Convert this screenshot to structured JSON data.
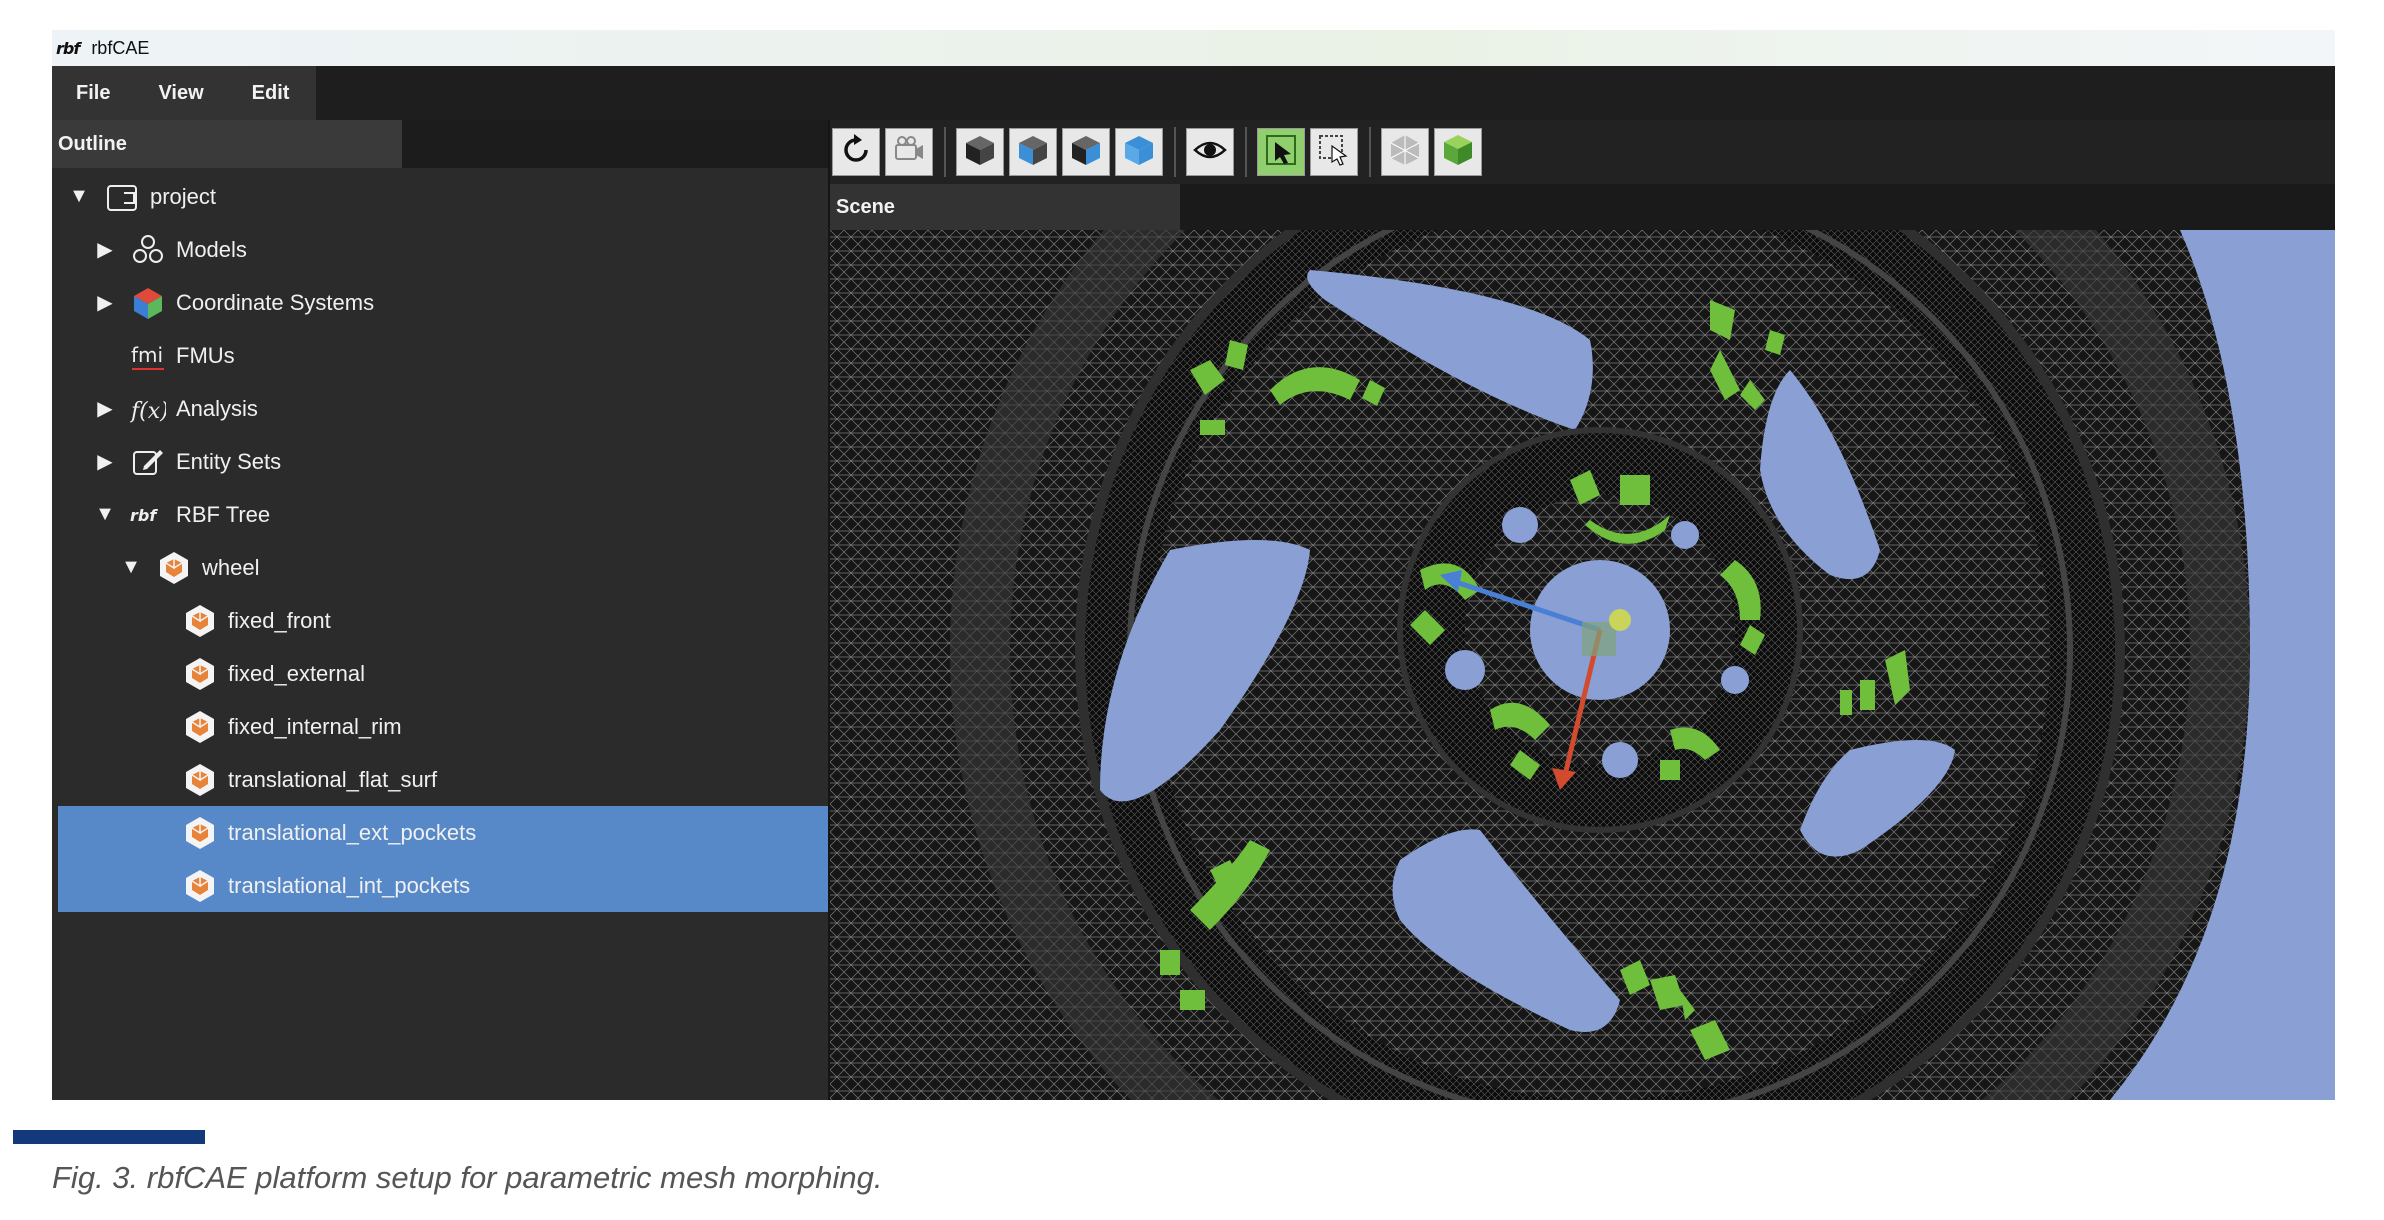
{
  "window": {
    "logo": "rbf",
    "title": "rbfCAE"
  },
  "menu": {
    "items": [
      "File",
      "View",
      "Edit"
    ]
  },
  "outline": {
    "tab_label": "Outline",
    "tree": [
      {
        "label": "project",
        "arrow": "▼",
        "icon": "folder-icon",
        "level": 0,
        "selected": false
      },
      {
        "label": "Models",
        "arrow": "▶",
        "icon": "models-icon",
        "level": 1,
        "selected": false
      },
      {
        "label": "Coordinate Systems",
        "arrow": "▶",
        "icon": "coordinate-systems-icon",
        "level": 1,
        "selected": false
      },
      {
        "label": "FMUs",
        "arrow": "",
        "icon": "fmi-icon",
        "level": 1,
        "selected": false
      },
      {
        "label": "Analysis",
        "arrow": "▶",
        "icon": "function-icon",
        "level": 1,
        "selected": false
      },
      {
        "label": "Entity Sets",
        "arrow": "▶",
        "icon": "edit-icon",
        "level": 1,
        "selected": false
      },
      {
        "label": "RBF Tree",
        "arrow": "▼",
        "icon": "rbf-icon",
        "level": 1,
        "selected": false
      },
      {
        "label": "wheel",
        "arrow": "▼",
        "icon": "rbf-node-icon",
        "level": 2,
        "selected": false
      },
      {
        "label": "fixed_front",
        "arrow": "",
        "icon": "rbf-node-icon",
        "level": 3,
        "selected": false
      },
      {
        "label": "fixed_external",
        "arrow": "",
        "icon": "rbf-node-icon",
        "level": 3,
        "selected": false
      },
      {
        "label": "fixed_internal_rim",
        "arrow": "",
        "icon": "rbf-node-icon",
        "level": 3,
        "selected": false
      },
      {
        "label": "translational_flat_surf",
        "arrow": "",
        "icon": "rbf-node-icon",
        "level": 3,
        "selected": false
      },
      {
        "label": "translational_ext_pockets",
        "arrow": "",
        "icon": "rbf-node-icon",
        "level": 3,
        "selected": true
      },
      {
        "label": "translational_int_pockets",
        "arrow": "",
        "icon": "rbf-node-icon",
        "level": 3,
        "selected": true
      }
    ]
  },
  "toolbar": {
    "buttons": [
      {
        "icon": "rotate-icon",
        "active": false
      },
      {
        "icon": "camera-icon",
        "active": false
      },
      {
        "icon": "view-cube-icon",
        "active": false
      },
      {
        "icon": "view-cube-side-icon",
        "active": false
      },
      {
        "icon": "view-cube-front-icon",
        "active": false
      },
      {
        "icon": "view-cube-top-icon",
        "active": false
      },
      {
        "icon": "eye-icon",
        "active": false
      },
      {
        "icon": "select-arrow-icon",
        "active": true
      },
      {
        "icon": "box-select-icon",
        "active": false
      },
      {
        "icon": "mesh-icon",
        "active": false
      },
      {
        "icon": "solid-cube-icon",
        "active": false
      }
    ]
  },
  "scene": {
    "tab_label": "Scene"
  },
  "colors": {
    "selection": "#5788c8",
    "background_blue": "#8aa0d4",
    "control_points": "#6fbe3c"
  },
  "caption": {
    "text": "Fig. 3. rbfCAE platform setup for parametric mesh morphing."
  }
}
